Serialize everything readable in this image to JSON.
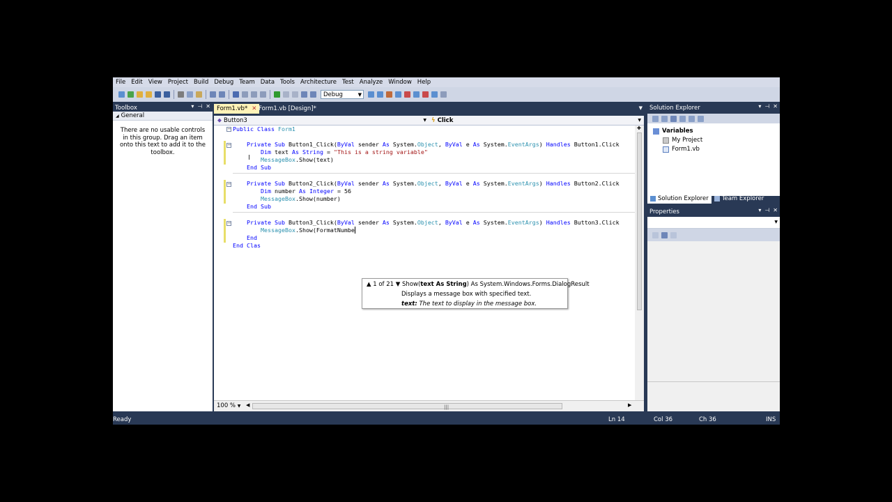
{
  "menu": [
    "File",
    "Edit",
    "View",
    "Project",
    "Build",
    "Debug",
    "Team",
    "Data",
    "Tools",
    "Architecture",
    "Test",
    "Analyze",
    "Window",
    "Help"
  ],
  "toolbar": {
    "config_value": "Debug"
  },
  "toolbox": {
    "title": "Toolbox",
    "group": "General",
    "empty_message": "There are no usable controls in this group. Drag an item onto this text to add it to the toolbox."
  },
  "tabs": [
    {
      "label": "Form1.vb*"
    },
    {
      "label": "Form1.vb [Design]*"
    }
  ],
  "editor": {
    "object_combo": "Button3",
    "event_combo": "Click",
    "zoom": "100 %"
  },
  "code": {
    "l1": [
      "Public Class",
      "Form1"
    ],
    "l3": [
      "Private Sub",
      "Button1_Click(",
      "ByVal",
      "sender",
      "As",
      "System.",
      "Object",
      ",",
      "ByVal",
      "e",
      "As",
      "System.",
      "EventArgs",
      ")",
      "Handles",
      "Button1.Click"
    ],
    "l4": [
      "Dim",
      "text",
      "As",
      "String",
      "=",
      "\"This is a string variable\""
    ],
    "l5": [
      "MessageBox",
      ".Show(text)"
    ],
    "l6": [
      "End Sub"
    ],
    "l8": [
      "Private Sub",
      "Button2_Click(",
      "ByVal",
      "sender",
      "As",
      "System.",
      "Object",
      ",",
      "ByVal",
      "e",
      "As",
      "System.",
      "EventArgs",
      ")",
      "Handles",
      "Button2.Click"
    ],
    "l9": [
      "Dim",
      "number",
      "As",
      "Integer",
      "= 56"
    ],
    "l10": [
      "MessageBox",
      ".Show(number)"
    ],
    "l11": [
      "End Sub"
    ],
    "l13": [
      "Private Sub",
      "Button3_Click(",
      "ByVal",
      "sender",
      "As",
      "System.",
      "Object",
      ",",
      "ByVal",
      "e",
      "As",
      "System.",
      "EventArgs",
      ")",
      "Handles",
      "Button3.Click"
    ],
    "l14": [
      "MessageBox",
      ".Show(FormatNumbe"
    ],
    "l15": "End",
    "l16": "End Clas"
  },
  "tooltip": {
    "counter": "1 of 21",
    "sig_prefix": "Show(",
    "sig_param": "text As String",
    "sig_suffix": ") As System.Windows.Forms.DialogResult",
    "description": "Displays a message box with specified text.",
    "param_name": "text:",
    "param_desc": "The text to display in the message box."
  },
  "solution_explorer": {
    "title": "Solution Explorer",
    "project": "Variables",
    "items": [
      "My Project",
      "Form1.vb"
    ],
    "tabs": [
      "Solution Explorer",
      "Team Explorer"
    ]
  },
  "properties": {
    "title": "Properties"
  },
  "status": {
    "left": "Ready",
    "ln": "Ln 14",
    "col": "Col 36",
    "ch": "Ch 36",
    "mode": "INS"
  }
}
